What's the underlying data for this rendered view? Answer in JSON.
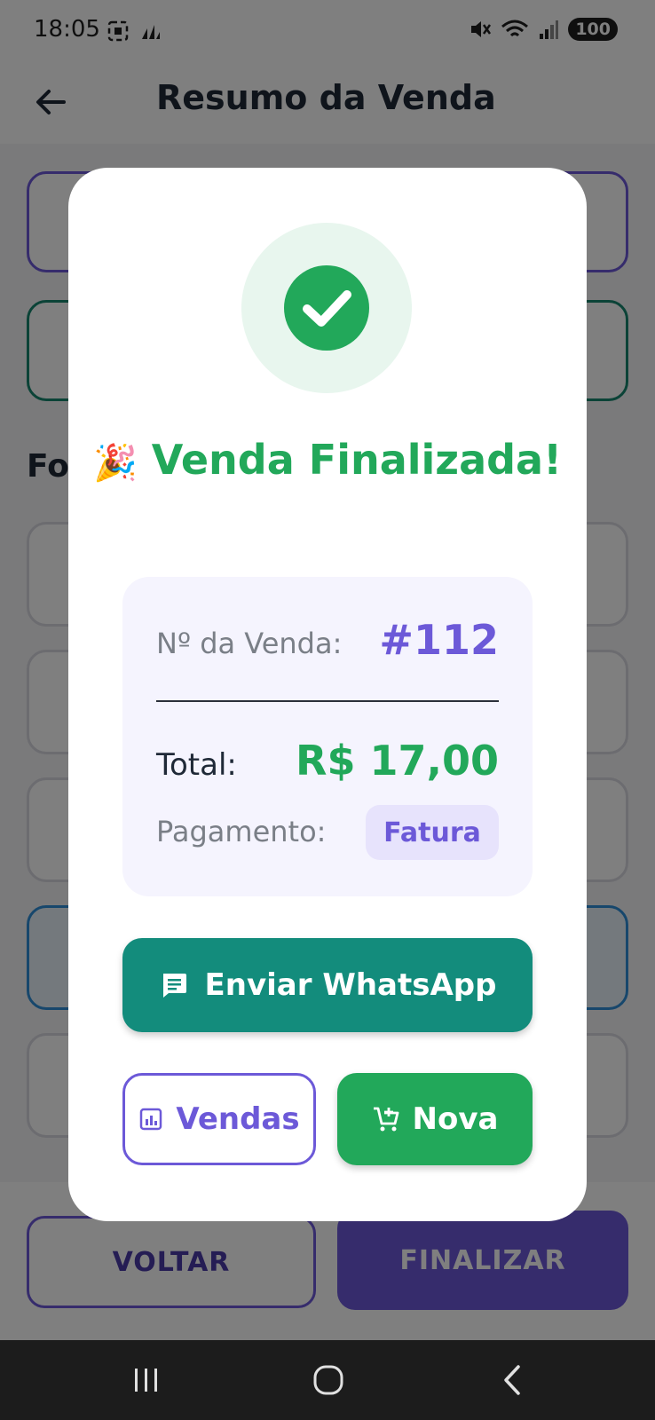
{
  "status_bar": {
    "time": "18:05",
    "battery": "100"
  },
  "app_bar": {
    "title": "Resumo da Venda"
  },
  "background": {
    "section_title_partial": "Fo"
  },
  "footer": {
    "back_label": "VOLTAR",
    "finish_label": "FINALIZAR"
  },
  "modal": {
    "title": "Venda Finalizada!",
    "sale_number_label": "Nº da Venda:",
    "sale_number": "#112",
    "total_label": "Total:",
    "total_value": "R$  17,00",
    "payment_label": "Pagamento:",
    "payment_method": "Fatura",
    "whatsapp_label": "Enviar WhatsApp",
    "sales_label": "Vendas",
    "new_label": "Nova"
  },
  "colors": {
    "success": "#22a85a",
    "primary": "#6c59d8",
    "whatsapp": "#138c7c"
  }
}
